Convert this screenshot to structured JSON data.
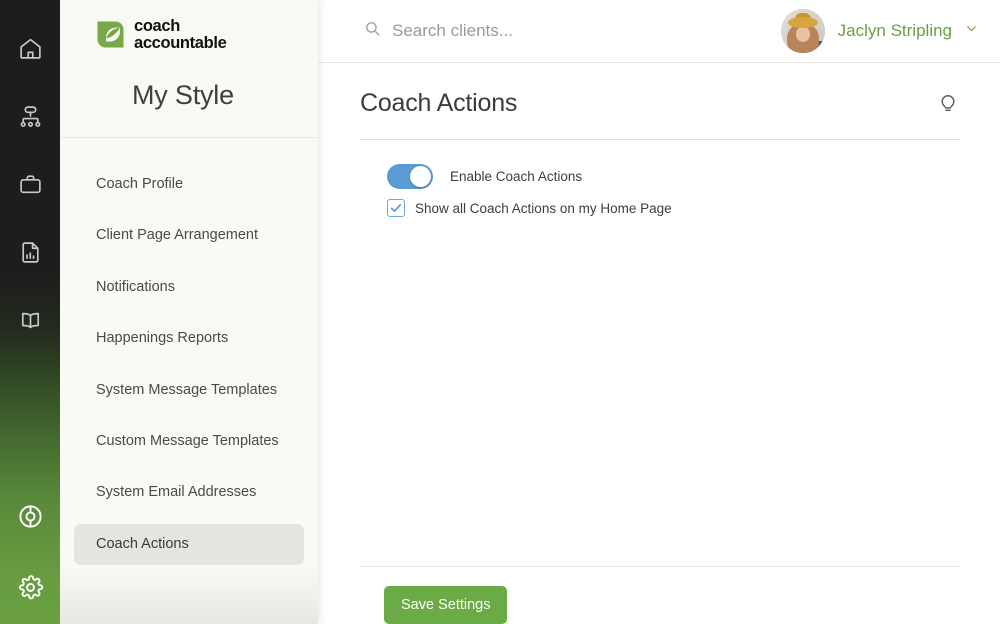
{
  "rail": {
    "items": [
      {
        "icon": "home-icon",
        "name": "rail-item-home"
      },
      {
        "icon": "org-chart-icon",
        "name": "rail-item-clients"
      },
      {
        "icon": "briefcase-icon",
        "name": "rail-item-work"
      },
      {
        "icon": "report-chart-icon",
        "name": "rail-item-reports"
      },
      {
        "icon": "book-icon",
        "name": "rail-item-library"
      }
    ],
    "bottom_items": [
      {
        "icon": "lifebuoy-icon",
        "name": "rail-item-support"
      },
      {
        "icon": "gear-icon",
        "name": "rail-item-settings"
      }
    ],
    "colors": {
      "top": "#1d1d1d",
      "bottom": "#6aa043"
    }
  },
  "sidebar": {
    "logo": {
      "line1": "coach",
      "line2": "accountable",
      "mark_color": "#78a847"
    },
    "title": "My Style",
    "items": [
      {
        "label": "Coach Profile",
        "active": false
      },
      {
        "label": "Client Page Arrangement",
        "active": false
      },
      {
        "label": "Notifications",
        "active": false
      },
      {
        "label": "Happenings Reports",
        "active": false
      },
      {
        "label": "System Message Templates",
        "active": false
      },
      {
        "label": "Custom Message Templates",
        "active": false
      },
      {
        "label": "System Email Addresses",
        "active": false
      },
      {
        "label": "Coach Actions",
        "active": true
      }
    ],
    "active_bg": "#e4e5e0"
  },
  "topbar": {
    "search_placeholder": "Search clients...",
    "user_name": "Jaclyn Stripling",
    "user_name_color": "#6aa043"
  },
  "page": {
    "title": "Coach Actions",
    "tip_icon": "lightbulb-icon"
  },
  "settings": {
    "toggle": {
      "label": "Enable Coach Actions",
      "on": true,
      "color": "#5b9bd5"
    },
    "checkbox": {
      "label": "Show all Coach Actions on my Home Page",
      "checked": true,
      "color": "#6ea8dc"
    }
  },
  "footer": {
    "save_label": "Save Settings",
    "save_color": "#6aab46"
  }
}
